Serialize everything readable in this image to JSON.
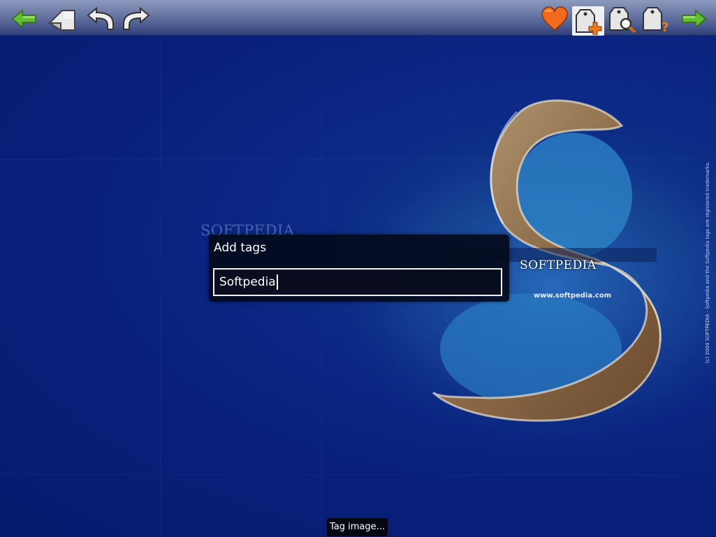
{
  "toolbar": {
    "left_icons": [
      "back-arrow-icon",
      "rotate-page-icon",
      "undo-icon",
      "redo-icon"
    ],
    "right_icons": [
      "favorite-heart-icon",
      "add-tag-icon",
      "search-tag-icon",
      "tag-help-icon",
      "forward-arrow-icon"
    ],
    "active_icon": "add-tag-icon"
  },
  "background": {
    "watermark_text": "SOFTPEDIA",
    "logo_text": "SOFTPEDIA",
    "logo_url": "www.softpedia.com",
    "side_text": "(c) 2004 SOFTPEDIA - Softpedia and the Softpedia logo are registered trademarks."
  },
  "dialog": {
    "title": "Add tags",
    "input_value": "Softpedia"
  },
  "status": {
    "text": "Tag image..."
  },
  "colors": {
    "background": "#08207c",
    "toolbar": "#6b7aa5",
    "arrow_green": "#5fbf2f",
    "heart_orange": "#f26b1d"
  }
}
